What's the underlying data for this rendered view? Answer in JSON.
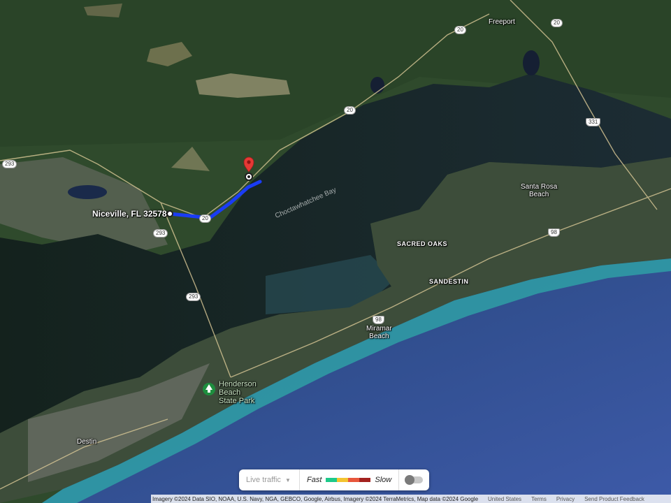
{
  "map": {
    "places": {
      "freeport": "Freeport",
      "santa_rosa_beach": "Santa Rosa\nBeach",
      "sacred_oaks": "SACRED OAKS",
      "sandestin": "SANDESTIN",
      "miramar_beach": "Miramar\nBeach",
      "destin": "Destin"
    },
    "water": {
      "bay": "Choctawhatchee Bay"
    },
    "park": "Henderson\nBeach\nState Park",
    "route": {
      "origin_label": "Niceville, FL 32578"
    },
    "roads": {
      "r20a": "20",
      "r20b": "20",
      "r20c": "20",
      "r20d": "20",
      "r293a": "293",
      "r293b": "293",
      "r293c": "293",
      "r331": "331",
      "r98a": "98",
      "r98b": "98"
    },
    "colors": {
      "route": "#1a3cf5",
      "pin": "#e53935"
    }
  },
  "traffic": {
    "live_label": "Live traffic",
    "fast_label": "Fast",
    "slow_label": "Slow",
    "scale_colors": [
      "#1ec98a",
      "#f3c431",
      "#e8573c",
      "#a3221f"
    ]
  },
  "footer": {
    "attribution": "Imagery ©2024 Data SIO, NOAA, U.S. Navy, NGA, GEBCO, Google, Airbus, Imagery ©2024 TerraMetrics, Map data ©2024 Google",
    "links": [
      "United States",
      "Terms",
      "Privacy",
      "Send Product Feedback"
    ]
  }
}
